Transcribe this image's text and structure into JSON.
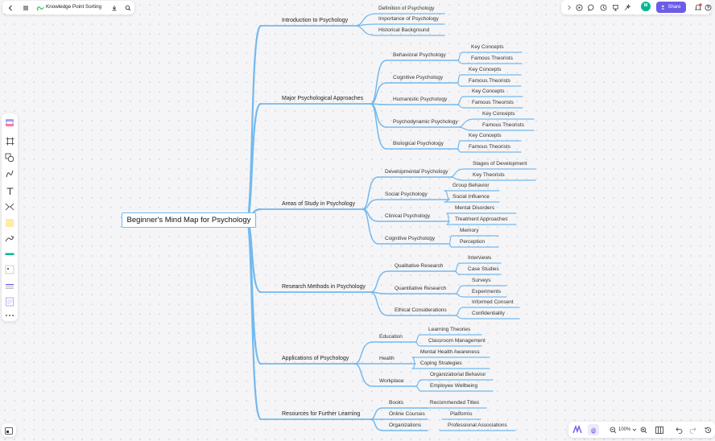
{
  "header": {
    "back_icon": "chevron-left-icon",
    "menu_icon": "hamburger-icon",
    "doc_icon": "mindmap-logo-icon",
    "title": "Knowledge Point Sorting",
    "download_icon": "download-icon",
    "search_icon": "search-icon"
  },
  "top_right": {
    "share_label": "Share",
    "avatar_initials": "M",
    "notification_count": "1"
  },
  "zoom": {
    "level": "100%"
  },
  "colors": {
    "accent": "#6c5ce7",
    "branch": "#74b9ef",
    "avatar": "#00b894"
  },
  "mindmap": {
    "root": "Beginner's Mind Map for Psychology",
    "branches": [
      {
        "label": "Introduction to Psychology",
        "leaves": [
          "Definition of Psychology",
          "Importance of Psychology",
          "Historical Background"
        ]
      },
      {
        "label": "Major Psychological Approaches",
        "children": [
          {
            "label": "Behavioral Psychology",
            "leaves": [
              "Key Concepts",
              "Famous Theorists"
            ]
          },
          {
            "label": "Cognitive Psychology",
            "leaves": [
              "Key Concepts",
              "Famous Theorists"
            ]
          },
          {
            "label": "Humanistic Psychology",
            "leaves": [
              "Key Concepts",
              "Famous Theorists"
            ]
          },
          {
            "label": "Psychodynamic Psychology",
            "leaves": [
              "Key Concepts",
              "Famous Theorists"
            ]
          },
          {
            "label": "Biological Psychology",
            "leaves": [
              "Key Concepts",
              "Famous Theorists"
            ]
          }
        ]
      },
      {
        "label": "Areas of Study in Psychology",
        "children": [
          {
            "label": "Developmental Psychology",
            "leaves": [
              "Stages of Development",
              "Key Theorists"
            ]
          },
          {
            "label": "Social Psychology",
            "leaves": [
              "Group Behavior",
              "Social Influence"
            ]
          },
          {
            "label": "Clinical Psychology",
            "leaves": [
              "Mental Disorders",
              "Treatment Approaches"
            ]
          },
          {
            "label": "Cognitive Psychology",
            "leaves": [
              "Memory",
              "Perception"
            ]
          }
        ]
      },
      {
        "label": "Research Methods in Psychology",
        "children": [
          {
            "label": "Qualitative Research",
            "leaves": [
              "Interviews",
              "Case Studies"
            ]
          },
          {
            "label": "Quantitative Research",
            "leaves": [
              "Surveys",
              "Experiments"
            ]
          },
          {
            "label": "Ethical Considerations",
            "leaves": [
              "Informed Consent",
              "Confidentiality"
            ]
          }
        ]
      },
      {
        "label": "Applications of Psychology",
        "children": [
          {
            "label": "Education",
            "leaves": [
              "Learning Theories",
              "Classroom Management"
            ]
          },
          {
            "label": "Health",
            "leaves": [
              "Mental Health Awareness",
              "Coping Strategies"
            ]
          },
          {
            "label": "Workplace",
            "leaves": [
              "Organizational Behavior",
              "Employee Wellbeing"
            ]
          }
        ]
      },
      {
        "label": "Resources for Further Learning",
        "children": [
          {
            "label": "Books",
            "leaves": [
              "Recommended Titles"
            ]
          },
          {
            "label": "Online Courses",
            "leaves": [
              "Platforms"
            ]
          },
          {
            "label": "Organizations",
            "leaves": [
              "Professional Associations"
            ]
          }
        ]
      }
    ]
  }
}
